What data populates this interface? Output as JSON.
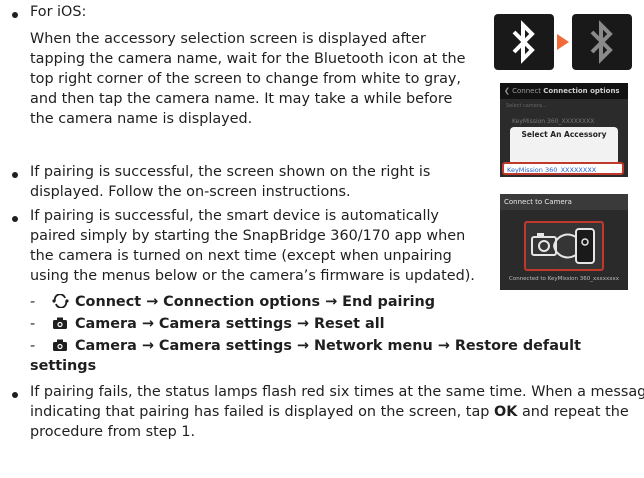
{
  "ios": {
    "heading": "For iOS:",
    "lines": [
      "When the accessory selection screen is displayed after",
      "tapping the camera name, wait for the Bluetooth icon at the",
      "top right corner of the screen to change from white to gray,",
      "and then tap the camera name. It may take a while before",
      "the camera name is displayed."
    ]
  },
  "bullet2": {
    "lines": [
      "If pairing is successful, the screen shown on the right is",
      "displayed. Follow the on-screen instructions."
    ]
  },
  "bullet3": {
    "lines": [
      "If pairing is successful, the smart device is automatically",
      "paired simply by starting the SnapBridge 360/170 app when",
      "the camera is turned on next time (except when unpairing",
      "using the menus below or the camera’s firmware is updated)."
    ]
  },
  "menu_paths": [
    {
      "icon": "connect-icon",
      "line1": "Connect → Connection options → End pairing",
      "line2": ""
    },
    {
      "icon": "camera-icon",
      "line1": "Camera → Camera settings → Reset all",
      "line2": ""
    },
    {
      "icon": "camera-icon",
      "line1": "Camera → Camera settings → Network menu → Restore default",
      "line2": "settings"
    }
  ],
  "bullet4": {
    "line1": "If pairing fails, the status lamps flash red six times at the same time. When a message",
    "line2_prefix": "indicating that pairing has failed is displayed on the screen, tap ",
    "line2_bold": "OK",
    "line2_suffix": " and repeat the",
    "line3": "procedure from step 1."
  },
  "screen1": {
    "back_label": "Connect",
    "title": "Connection options",
    "faint1": "Select camera...",
    "faint2": "KeyMission 360_XXXXXXXX",
    "dialog_title": "Select An Accessory",
    "selected_item": "KeyMission 360_XXXXXXXX"
  },
  "screen2": {
    "title": "Connect to Camera",
    "footer": "Connected to KeyMission 360_xxxxxxxx"
  },
  "colors": {
    "accent": "#f16a3a",
    "highlight": "#c0392b",
    "link": "#2563c7"
  }
}
